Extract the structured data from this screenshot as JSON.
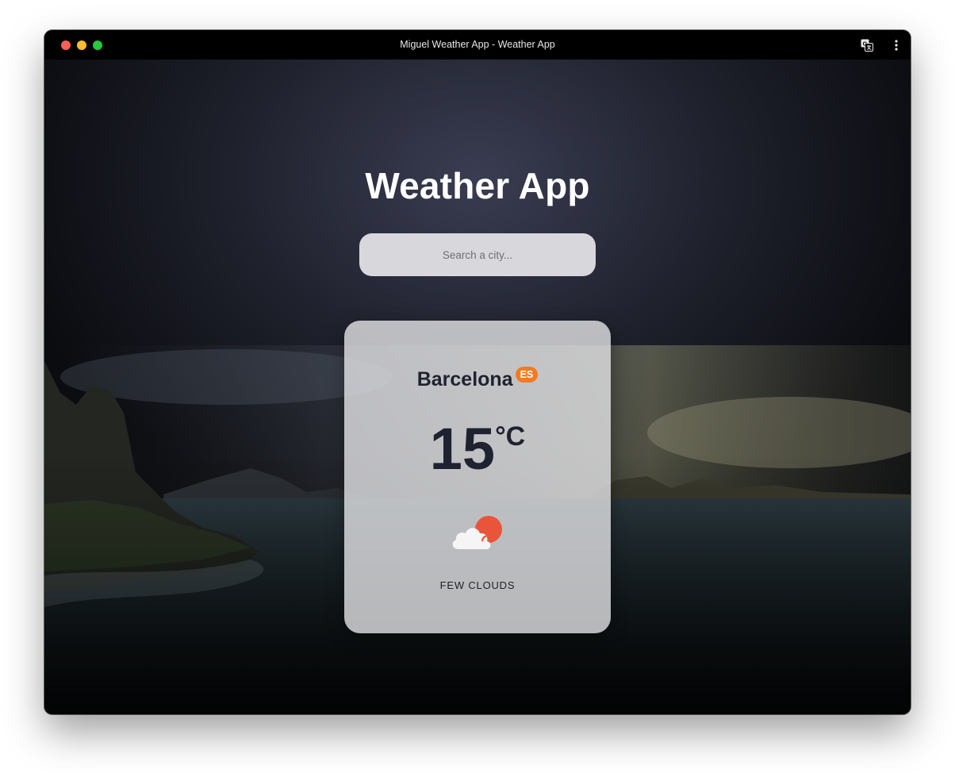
{
  "window": {
    "title": "Miguel Weather App - Weather App"
  },
  "toolbar": {
    "translate_icon": "translate-icon",
    "menu_icon": "more-vertical-icon"
  },
  "app": {
    "title": "Weather App"
  },
  "search": {
    "placeholder": "Search a city...",
    "value": ""
  },
  "weather": {
    "city": "Barcelona",
    "country_code": "ES",
    "temperature": "15",
    "unit": "°C",
    "icon": "few-clouds-day-icon",
    "description": "FEW CLOUDS"
  },
  "colors": {
    "badge": "#f47b20",
    "sun": "#e8553b",
    "text_dark": "#1f2230"
  }
}
